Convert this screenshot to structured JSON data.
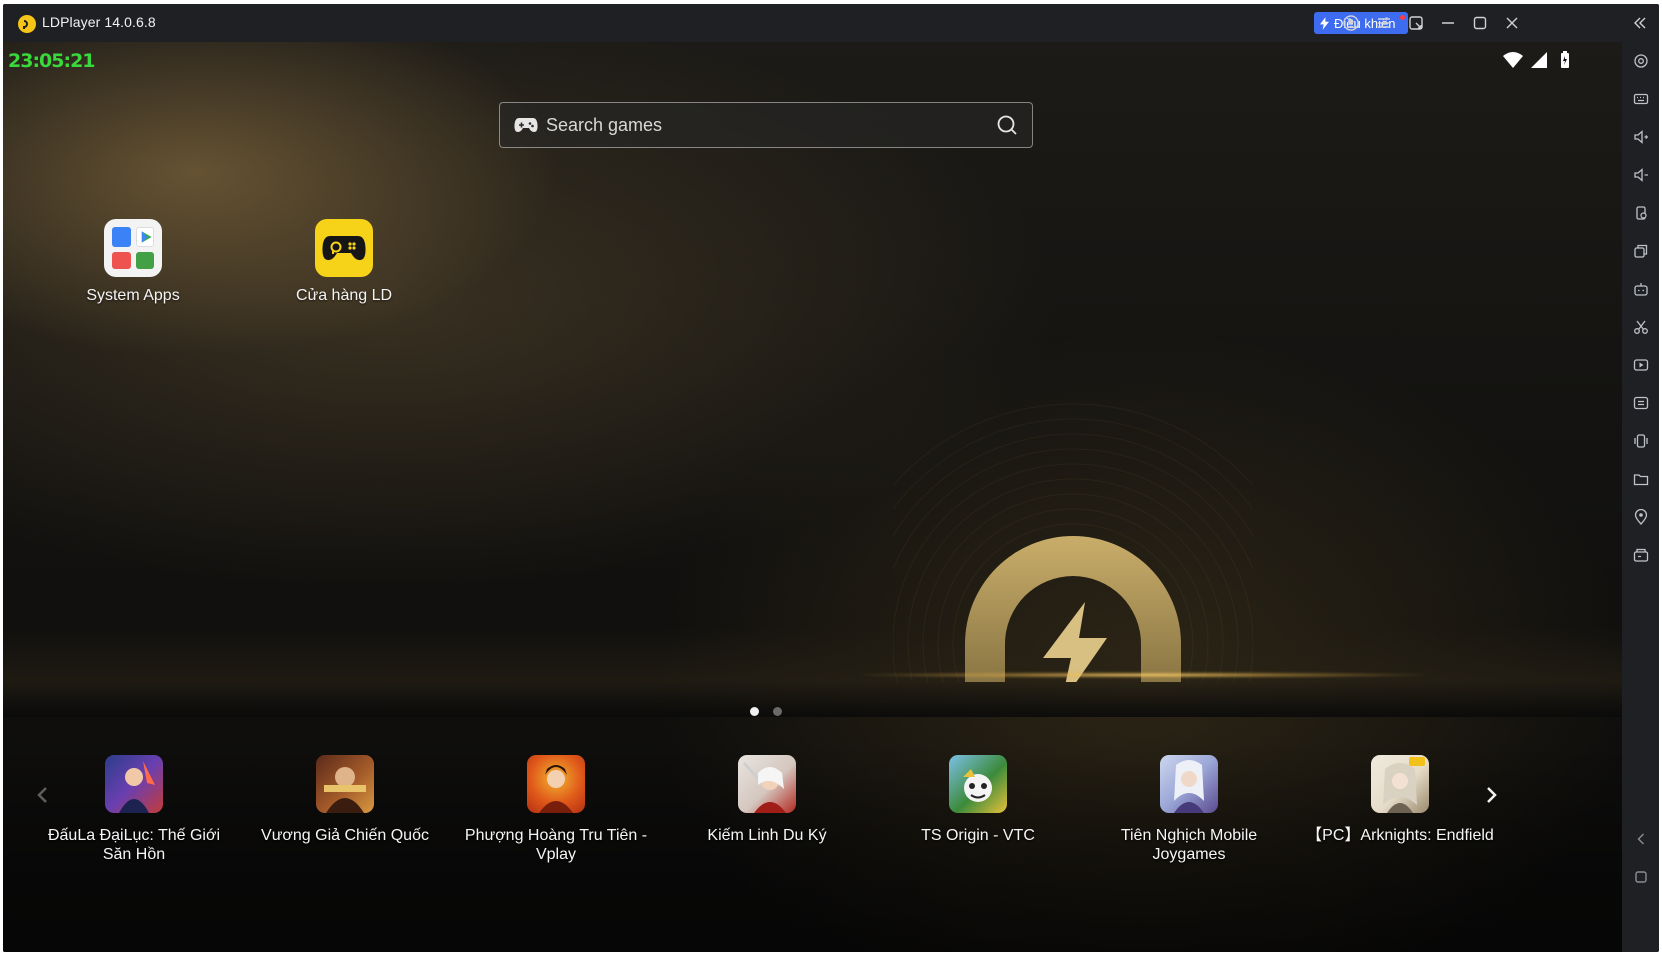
{
  "window": {
    "title": "LDPlayer 14.0.6.8",
    "control_badge": "Điều khiển",
    "accent": "#3d6cf0"
  },
  "titlebar_icons": [
    "account-icon",
    "menu-icon",
    "popout-icon",
    "minimize-icon",
    "maximize-icon",
    "close-icon",
    "collapse-sidebar-icon"
  ],
  "status_bar": {
    "clock": "23:05:21",
    "clock_color": "#39d93b",
    "icons": [
      "wifi-icon",
      "signal-icon",
      "battery-icon"
    ]
  },
  "search": {
    "placeholder": "Search games"
  },
  "home_apps": [
    {
      "label": "System Apps",
      "icon": "system-apps-folder-icon"
    },
    {
      "label": "Cửa hàng LD",
      "icon": "ld-store-icon"
    }
  ],
  "pager": {
    "pages": 2,
    "current": 1
  },
  "dock_games": [
    {
      "label": "ĐấuLa ĐạiLục: Thế Giới Săn Hồn",
      "colors": [
        "#2b3e8a",
        "#c43b3b"
      ]
    },
    {
      "label": "Vương Giả Chiến Quốc",
      "colors": [
        "#5a2a1a",
        "#d89a40"
      ]
    },
    {
      "label": "Phượng Hoàng Tru Tiên - Vplay",
      "colors": [
        "#b42f12",
        "#f2b531"
      ]
    },
    {
      "label": "Kiếm Linh Du Ký",
      "colors": [
        "#e9e4e0",
        "#b2281f"
      ]
    },
    {
      "label": "TS Origin - VTC",
      "colors": [
        "#3c8a3b",
        "#e7c23a"
      ]
    },
    {
      "label": "Tiên Nghịch Mobile Joygames",
      "colors": [
        "#cdd6ee",
        "#5b4a8f"
      ]
    },
    {
      "label": "【PC】Arknights: Endfield",
      "colors": [
        "#e6dcc8",
        "#9a8a6e"
      ]
    }
  ],
  "sidebar_icons": [
    "settings-icon",
    "keyboard-icon",
    "volume-up-icon",
    "volume-down-icon",
    "rotate-icon",
    "multi-instance-icon",
    "robot-icon",
    "scissors-icon",
    "record-icon",
    "sync-icon",
    "shake-icon",
    "folder-icon",
    "location-icon",
    "operation-icon",
    "back-icon",
    "home-icon"
  ]
}
